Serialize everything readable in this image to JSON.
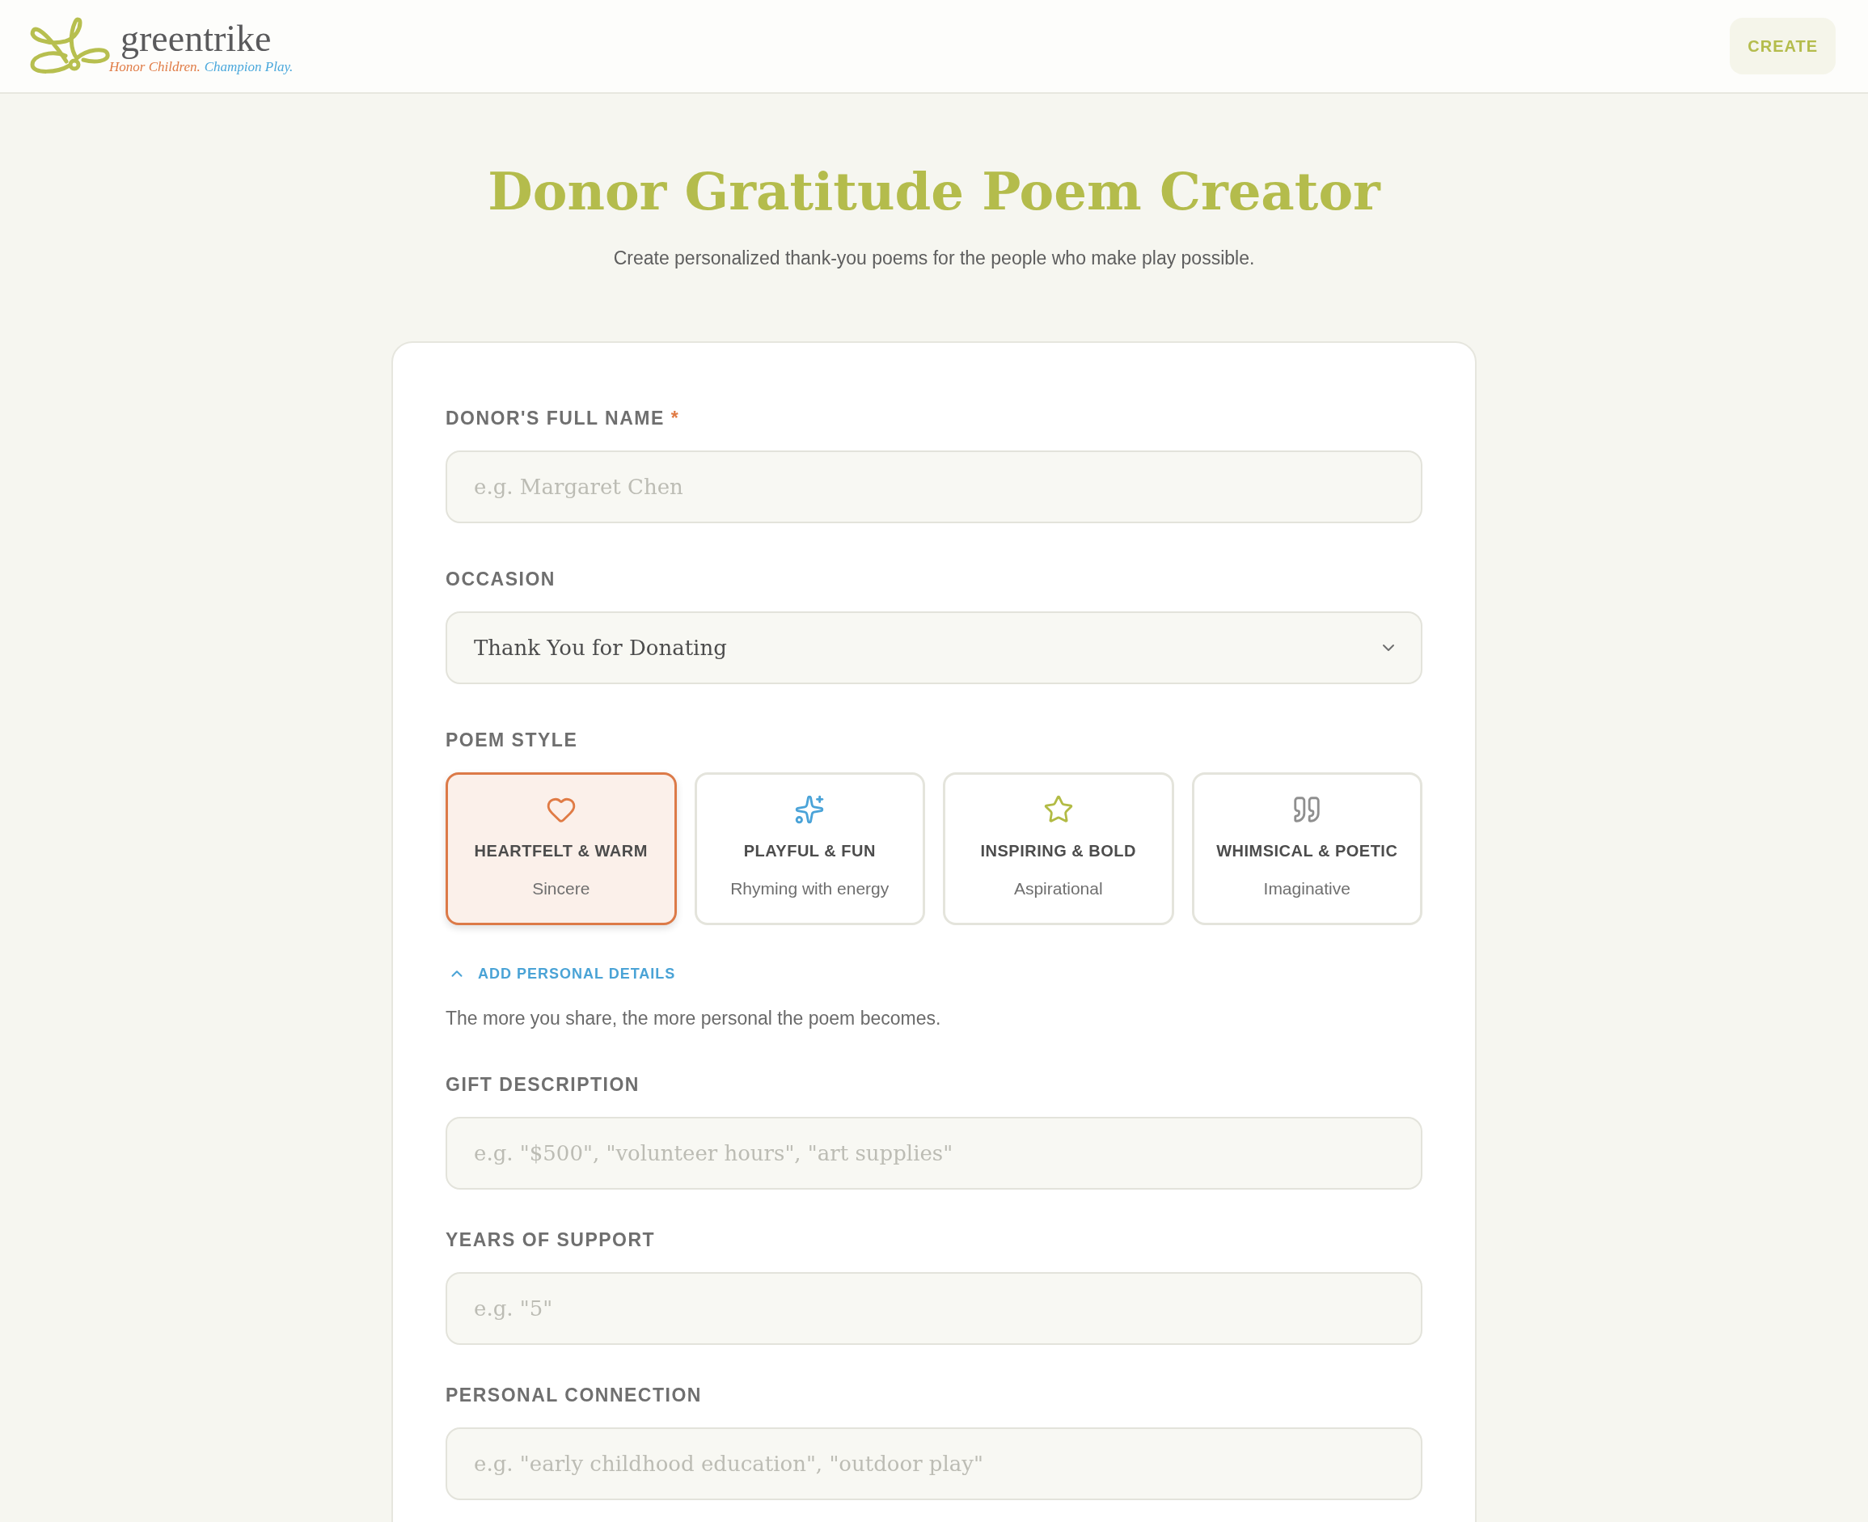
{
  "header": {
    "logo": {
      "wordmark": "greentrike",
      "tagline": [
        {
          "text": "Honor Children.",
          "color": "#e07b45"
        },
        {
          "text": "Champion Play.",
          "color": "#4aa8dc"
        }
      ]
    },
    "create_button": "CREATE"
  },
  "page": {
    "title": "Donor Gratitude Poem Creator",
    "subtitle": "Create personalized thank-you poems for the people who make play possible."
  },
  "form": {
    "fields": [
      {
        "kind": "text",
        "label": "DONOR'S FULL NAME",
        "required_mark": "*",
        "placeholder": "e.g. Margaret Chen"
      },
      {
        "kind": "select",
        "label": "OCCASION",
        "value": "Thank You for Donating"
      }
    ],
    "poem_style": {
      "label": "POEM STYLE",
      "options": [
        {
          "title": "HEARTFELT & WARM",
          "subtitle": "Sincere",
          "color": "#e07b45",
          "selected": true
        },
        {
          "title": "PLAYFUL & FUN",
          "subtitle": "Rhyming with energy",
          "color": "#4aa3d8",
          "selected": false
        },
        {
          "title": "INSPIRING & BOLD",
          "subtitle": "Aspirational",
          "color": "#b2bb45",
          "selected": false
        },
        {
          "title": "WHIMSICAL & POETIC",
          "subtitle": "Imaginative",
          "color": "#8f8f8f",
          "selected": false
        }
      ]
    },
    "personal_details": {
      "toggle": "ADD PERSONAL DETAILS",
      "expanded": true,
      "hint": "The more you share, the more personal the poem becomes.",
      "fields": [
        {
          "kind": "text",
          "label": "GIFT DESCRIPTION",
          "placeholder": "e.g. \"$500\", \"volunteer hours\", \"art supplies\""
        },
        {
          "kind": "text",
          "label": "YEARS OF SUPPORT",
          "placeholder": "e.g. \"5\""
        },
        {
          "kind": "text",
          "label": "PERSONAL CONNECTION",
          "placeholder": "e.g. \"early childhood education\", \"outdoor play\""
        }
      ]
    }
  }
}
